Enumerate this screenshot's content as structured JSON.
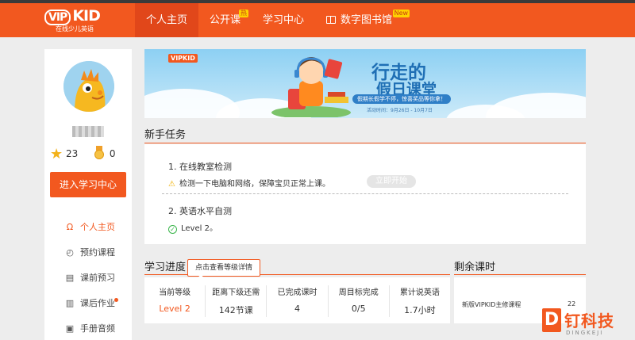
{
  "header": {
    "logo_word_prefix": "VIP",
    "logo_word": "KID",
    "logo_subtitle": "在线少儿英语",
    "nav": [
      {
        "label": "个人主页",
        "badge": ""
      },
      {
        "label": "公开课",
        "badge": "热"
      },
      {
        "label": "学习中心",
        "badge": ""
      },
      {
        "label": "数字图书馆",
        "badge": "New"
      }
    ],
    "accent_color": "#f2581f"
  },
  "sidebar": {
    "star_count": "23",
    "medal_count": "0",
    "enter_button": "进入学习中心",
    "menu": [
      {
        "label": "个人主页",
        "icon": "user-icon",
        "glyph": "Ω"
      },
      {
        "label": "预约课程",
        "icon": "clock-icon",
        "glyph": "◴"
      },
      {
        "label": "课前预习",
        "icon": "preview-icon",
        "glyph": "▤"
      },
      {
        "label": "课后作业",
        "icon": "homework-icon",
        "glyph": "▥"
      },
      {
        "label": "手册音频",
        "icon": "audio-icon",
        "glyph": "▣"
      }
    ]
  },
  "banner": {
    "logo": "VIPKID",
    "title_line1": "行走的",
    "title_line2": "假日课堂",
    "tagline": "假期长假学不停，惊喜奖品等你拿！",
    "date": "活动时间：9月26日 - 10月7日"
  },
  "tasks": {
    "heading": "新手任务",
    "items": [
      {
        "title": "1. 在线教室检测",
        "desc": "检测一下电脑和网络，保障宝贝正常上课。",
        "action": "立即开始"
      },
      {
        "title": "2. 英语水平自测",
        "desc": "Level 2。"
      }
    ]
  },
  "progress": {
    "heading": "学习进度",
    "tooltip": "点击查看等级详情",
    "columns": [
      {
        "label": "当前等级",
        "value": "Level 2"
      },
      {
        "label": "距离下级还需",
        "value": "142节课"
      },
      {
        "label": "已完成课时",
        "value": "4"
      },
      {
        "label": "周目标完成",
        "value": "0/5"
      },
      {
        "label": "累计说英语",
        "value": "1.7小时"
      }
    ]
  },
  "remaining": {
    "heading": "剩余课时",
    "course": "新版VIPKID主修课程",
    "count": "22"
  },
  "watermark": {
    "letter": "D",
    "name": "钉科技",
    "sub": "DINGKEJI"
  }
}
